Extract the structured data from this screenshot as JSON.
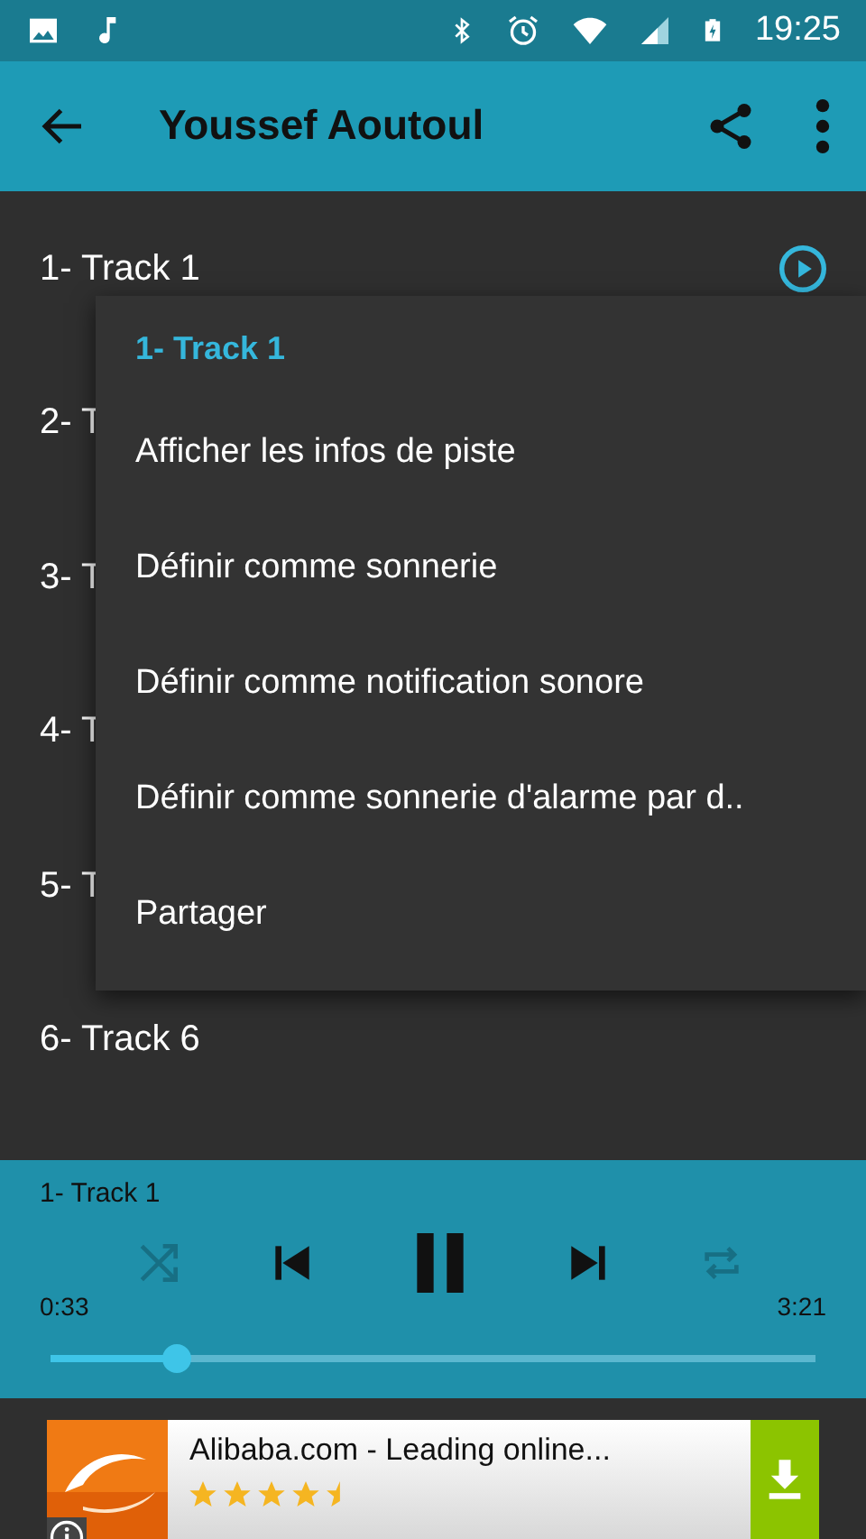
{
  "status_bar": {
    "time": "19:25"
  },
  "app_bar": {
    "title": "Youssef Aoutoul"
  },
  "tracks": [
    {
      "title": "1- Track 1",
      "kind": "current"
    },
    {
      "title": "2- T",
      "kind": "plain"
    },
    {
      "title": "3- T",
      "kind": "plain"
    },
    {
      "title": "4- T",
      "kind": "plain"
    },
    {
      "title": "5- T",
      "kind": "plain"
    },
    {
      "title": "6- Track 6",
      "kind": "plain"
    }
  ],
  "context_menu": {
    "title": "1- Track 1",
    "items": [
      "Afficher les infos de piste",
      "Définir comme sonnerie",
      "Définir comme notification sonore",
      "Définir comme sonnerie d'alarme par d..",
      "Partager"
    ]
  },
  "player": {
    "track": "1- Track 1",
    "shuffle": false,
    "repeat": false,
    "playing": true,
    "elapsed": "0:33",
    "duration": "3:21",
    "level": 0.165
  },
  "ad": {
    "title": "Alibaba.com - Leading online...",
    "stars": 4.5
  }
}
